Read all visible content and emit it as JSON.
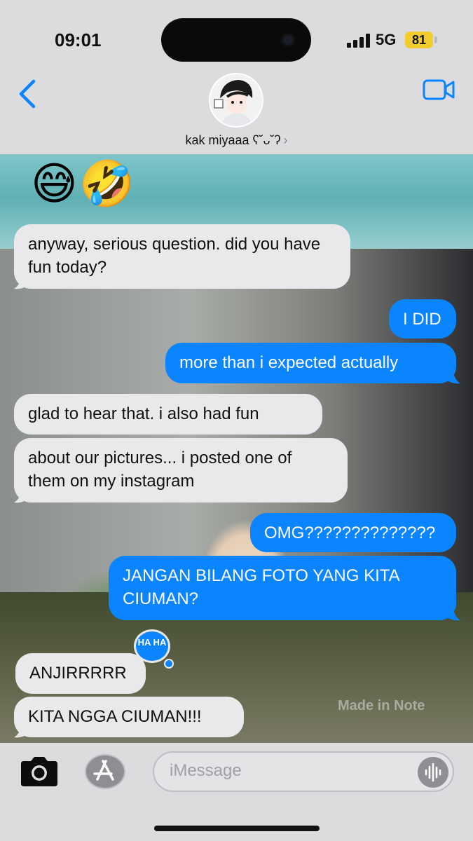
{
  "status_bar": {
    "time": "09:01",
    "network": "5G",
    "battery": "81"
  },
  "header": {
    "contact_name": "kak miyaaa ʕ˘ᴗ˘ʔ",
    "chevron": "›"
  },
  "messages": {
    "emojis": "😅🤣",
    "m1": "anyway, serious question. did you have fun today?",
    "m2": "I DID",
    "m3": "more than i expected actually",
    "m4": "glad to hear that. i also had fun",
    "m5": "about our pictures... i posted one of them on my instagram",
    "m6": "OMG??????????????",
    "m7": "JANGAN BILANG FOTO YANG KITA CIUMAN?",
    "m8": "ANJIRRRRR",
    "m9": "KITA NGGA CIUMAN!!!",
    "reaction": "HA HA"
  },
  "background": {
    "watermark": "Made in Note"
  },
  "input": {
    "placeholder": "iMessage"
  },
  "colors": {
    "outgoing": "#0a84ff",
    "incoming": "#e9e9eb",
    "link": "#0a84ff"
  }
}
